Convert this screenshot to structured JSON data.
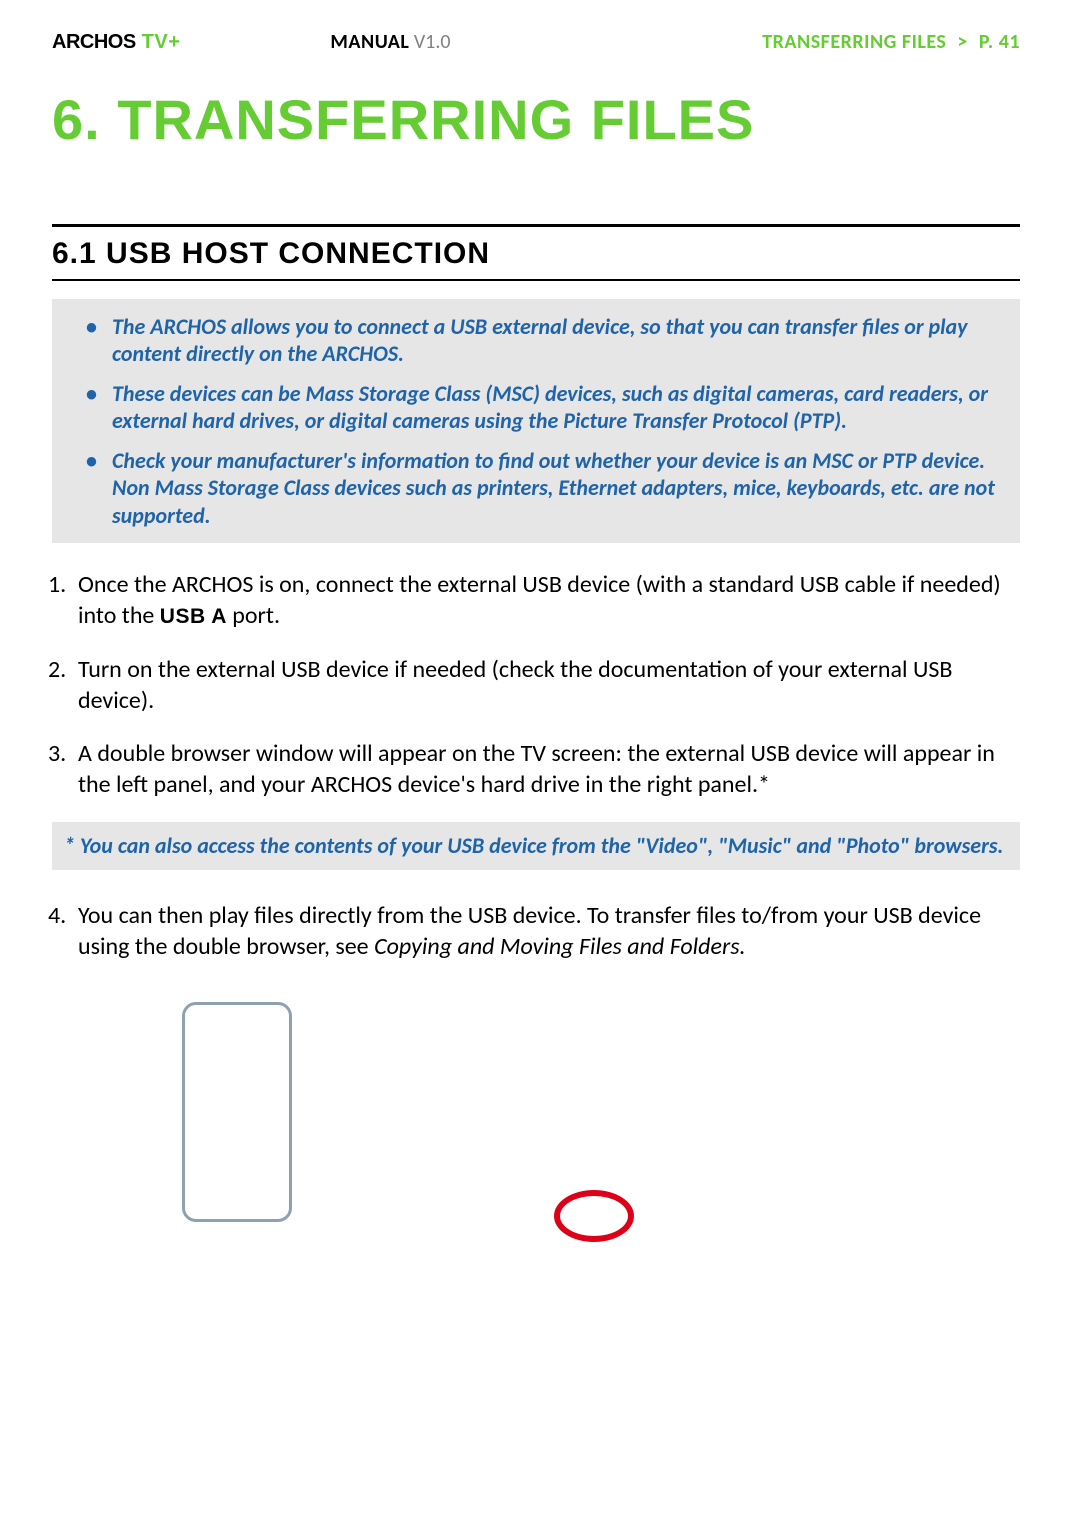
{
  "header": {
    "brand_archos": "ARCHOS",
    "brand_tvplus": "TV+",
    "manual_label": "MANUAL",
    "version": "V1.0",
    "breadcrumb_section": "TRANSFERRING FILES",
    "breadcrumb_sep": ">",
    "page_label": "P. 41"
  },
  "chapter": {
    "number": "6.",
    "title_rest": "TRANSFERRING FILES"
  },
  "section": {
    "heading": "6.1 USB HOST CONNECTION"
  },
  "info_bullets": [
    "The ARCHOS allows you to connect a USB external device, so that you can transfer files or play content directly on the ARCHOS.",
    "These devices can be Mass Storage Class (MSC) devices, such as digital cameras, card readers, or external hard drives, or digital cameras using the Picture Transfer Protocol (PTP).",
    "Check your manufacturer's information to find out whether your device is an MSC or PTP device. Non Mass Storage Class devices such as printers, Ethernet adapters, mice, keyboards, etc. are not supported."
  ],
  "steps": {
    "s1_a": "Once the ARCHOS is on, connect the external USB device (with a standard USB cable if needed) into the ",
    "s1_usb": "USB A",
    "s1_b": " port.",
    "s2": "Turn on the external USB device if needed (check the documentation of your external USB device).",
    "s3": "A double browser window will appear on the TV screen: the external USB device will appear in the left panel, and your ARCHOS device's hard drive in the right panel.*"
  },
  "footnote": "* You can also access the contents of your USB device from the \"Video\", \"Music\" and \"Photo\" browsers.",
  "step4_a": "You can then play files directly from the USB device. To transfer files to/from your USB device using the double browser, see ",
  "step4_ref": "Copying and Moving Files and Folders.",
  "diagram": {
    "phone_label": "device-outline",
    "oval_label": "highlight-oval"
  }
}
